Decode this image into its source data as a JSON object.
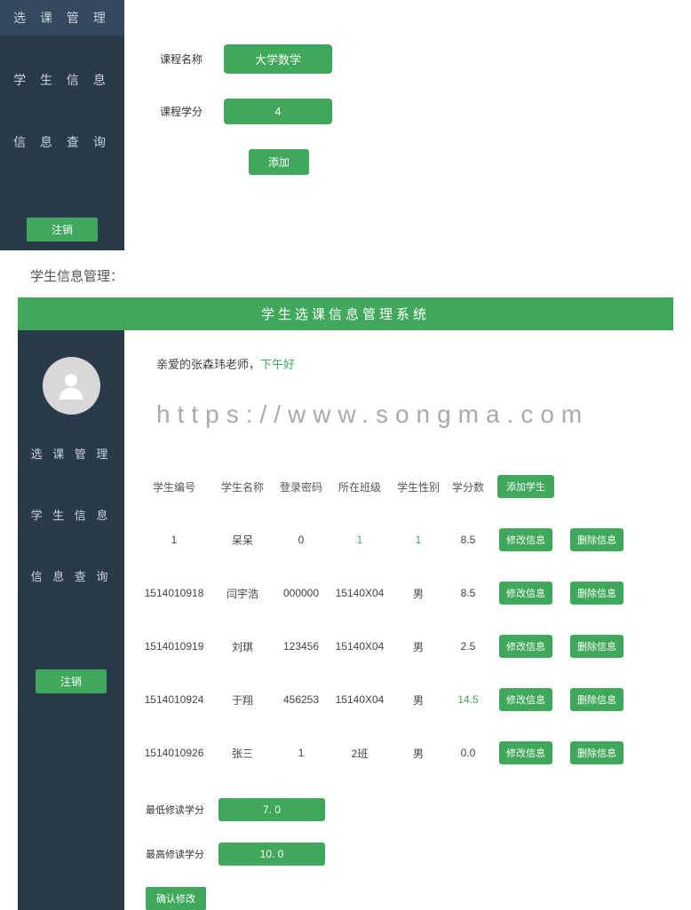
{
  "top": {
    "sidebar": {
      "items": [
        "选 课 管 理",
        "学 生 信 息",
        "信 息 查 询"
      ],
      "logout": "注销"
    },
    "form": {
      "course_name_label": "课程名称",
      "course_name_value": "大学数学",
      "course_credit_label": "课程学分",
      "course_credit_value": "4",
      "add_btn": "添加"
    }
  },
  "section_title": "学生信息管理：",
  "header_title": "学生选课信息管理系统",
  "lower": {
    "sidebar": {
      "items": [
        "选 课 管 理",
        "学 生 信 息",
        "信 息 查 询"
      ],
      "logout": "注销"
    },
    "greeting_prefix": "亲爱的张森玮老师，",
    "greeting_suffix": "下午好",
    "watermark": "https://www.songma.com",
    "table": {
      "headers": [
        "学生编号",
        "学生名称",
        "登录密码",
        "所在班级",
        "学生性别",
        "学分数"
      ],
      "add_student_btn": "添加学生",
      "edit_btn": "修改信息",
      "delete_btn": "删除信息",
      "rows": [
        {
          "id": "1",
          "name": "呆呆",
          "pw": "0",
          "cls": "1",
          "sex": "1",
          "credit": "8.5",
          "linkstyle": true
        },
        {
          "id": "1514010918",
          "name": "闫宇浩",
          "pw": "000000",
          "cls": "15140X04",
          "sex": "男",
          "credit": "8.5"
        },
        {
          "id": "1514010919",
          "name": "刘琪",
          "pw": "123456",
          "cls": "15140X04",
          "sex": "男",
          "credit": "2.5"
        },
        {
          "id": "1514010924",
          "name": "于翔",
          "pw": "456253",
          "cls": "15140X04",
          "sex": "男",
          "credit": "14.5",
          "creditgreen": true
        },
        {
          "id": "1514010926",
          "name": "张三",
          "pw": "1",
          "cls": "2班",
          "sex": "男",
          "credit": "0.0",
          "pwgreen": true
        }
      ]
    },
    "bottom_form": {
      "min_label": "最低修读学分",
      "min_value": "7. 0",
      "max_label": "最高修读学分",
      "max_value": "10. 0",
      "confirm": "确认修改"
    }
  }
}
